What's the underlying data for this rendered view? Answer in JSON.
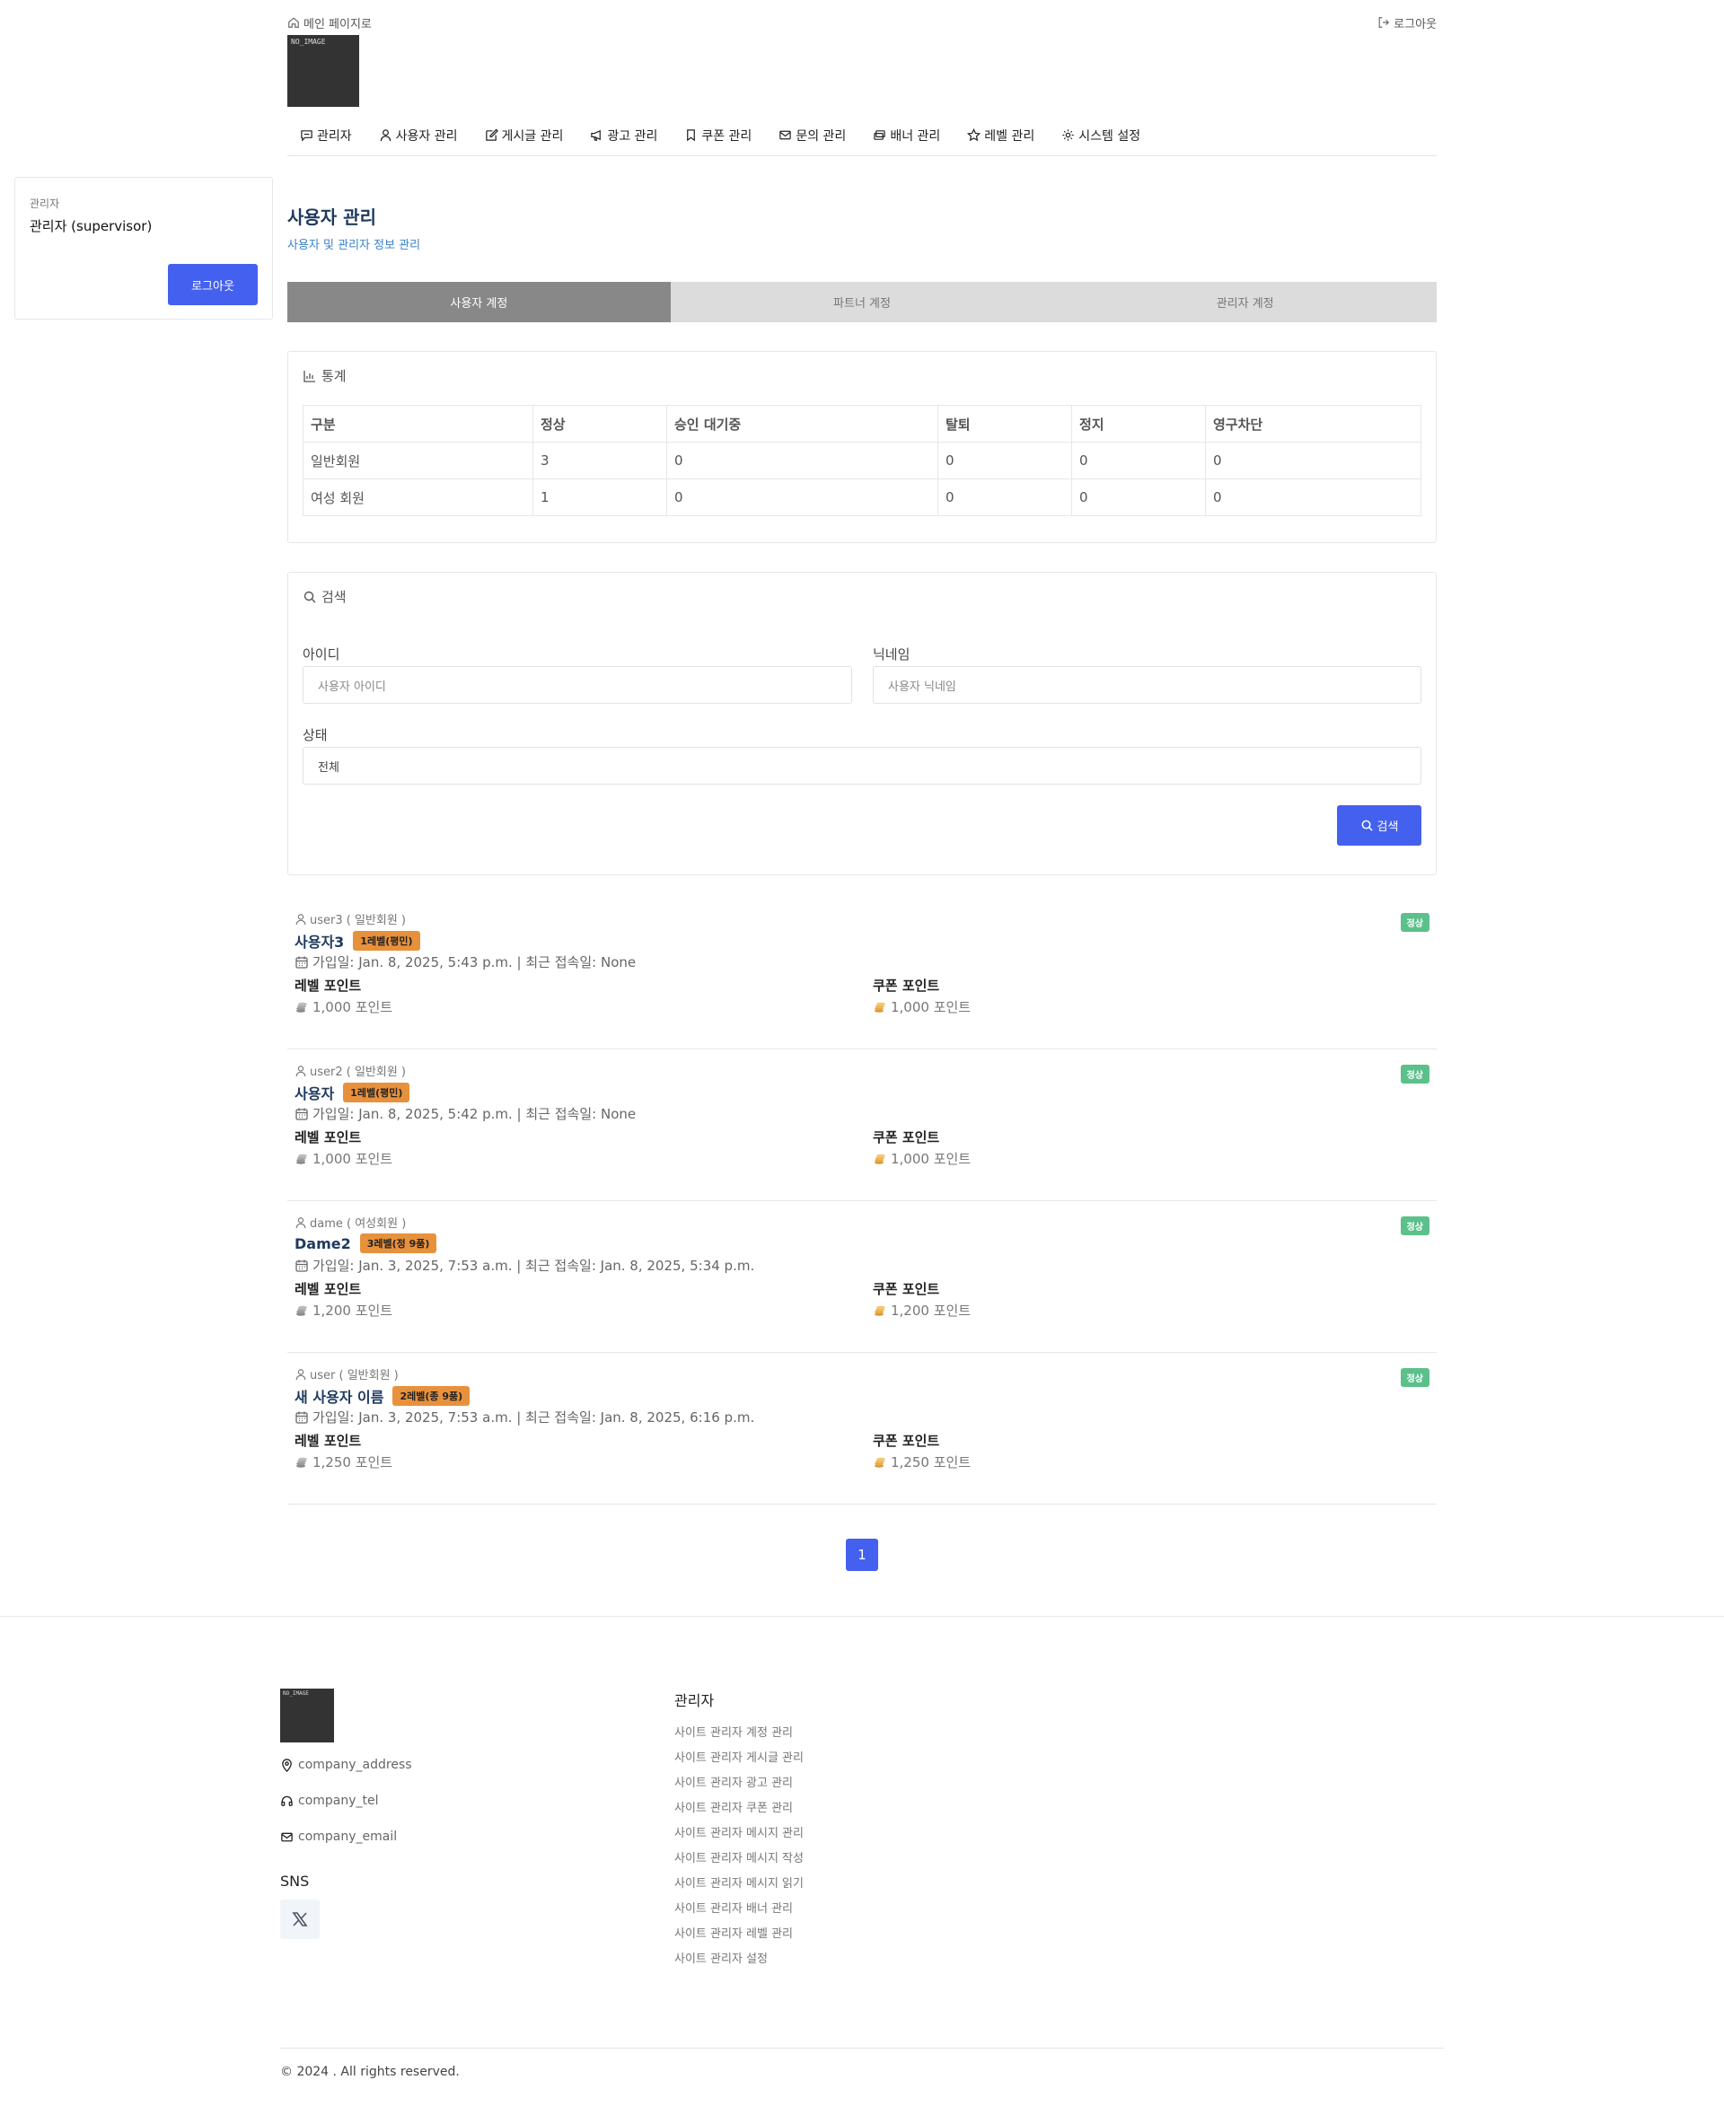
{
  "header": {
    "home_link": "메인 페이지로",
    "logout_link": "로그아웃",
    "logo_text": "NO_IMAGE"
  },
  "nav": {
    "items": [
      {
        "label": "관리자",
        "icon": "chat-icon"
      },
      {
        "label": "사용자 관리",
        "icon": "user-icon"
      },
      {
        "label": "게시글 관리",
        "icon": "edit-icon"
      },
      {
        "label": "광고 관리",
        "icon": "megaphone-icon"
      },
      {
        "label": "쿠폰 관리",
        "icon": "coupon-icon"
      },
      {
        "label": "문의 관리",
        "icon": "mail-icon"
      },
      {
        "label": "배너 관리",
        "icon": "banner-icon"
      },
      {
        "label": "레벨 관리",
        "icon": "star-icon"
      },
      {
        "label": "시스템 설정",
        "icon": "gear-icon"
      }
    ]
  },
  "sidebar": {
    "role": "관리자",
    "user": "관리자 (supervisor)",
    "logout_button": "로그아웃"
  },
  "page": {
    "title": "사용자 관리",
    "subtitle": "사용자 및 관리자 정보 관리"
  },
  "tabs": [
    {
      "label": "사용자 계정",
      "active": true
    },
    {
      "label": "파트너 계정",
      "active": false
    },
    {
      "label": "관리자 계정",
      "active": false
    }
  ],
  "stats": {
    "title": "통계",
    "headers": [
      "구분",
      "정상",
      "승인 대기중",
      "탈퇴",
      "정지",
      "영구차단"
    ],
    "rows": [
      [
        "일반회원",
        "3",
        "0",
        "0",
        "0",
        "0"
      ],
      [
        "여성 회원",
        "1",
        "0",
        "0",
        "0",
        "0"
      ]
    ]
  },
  "search": {
    "title": "검색",
    "id_label": "아이디",
    "id_placeholder": "사용자 아이디",
    "nick_label": "닉네임",
    "nick_placeholder": "사용자 닉네임",
    "status_label": "상태",
    "status_value": "전체",
    "button": "검색"
  },
  "users": [
    {
      "id": "user3 ( 일반회원 )",
      "name": "사용자3",
      "level": "1레벨(평민)",
      "dates": "가입일: Jan. 8, 2025, 5:43 p.m. | 최근 접속일: None",
      "level_point_label": "레벨 포인트",
      "level_point": "1,000 포인트",
      "coupon_point_label": "쿠폰 포인트",
      "coupon_point": "1,000 포인트",
      "status": "정상"
    },
    {
      "id": "user2 ( 일반회원 )",
      "name": "사용자",
      "level": "1레벨(평민)",
      "dates": "가입일: Jan. 8, 2025, 5:42 p.m. | 최근 접속일: None",
      "level_point_label": "레벨 포인트",
      "level_point": "1,000 포인트",
      "coupon_point_label": "쿠폰 포인트",
      "coupon_point": "1,000 포인트",
      "status": "정상"
    },
    {
      "id": "dame ( 여성회원 )",
      "name": "Dame2",
      "level": "3레벨(정 9품)",
      "dates": "가입일: Jan. 3, 2025, 7:53 a.m. | 최근 접속일: Jan. 8, 2025, 5:34 p.m.",
      "level_point_label": "레벨 포인트",
      "level_point": "1,200 포인트",
      "coupon_point_label": "쿠폰 포인트",
      "coupon_point": "1,200 포인트",
      "status": "정상"
    },
    {
      "id": "user ( 일반회원 )",
      "name": "새 사용자 이름",
      "level": "2레벨(종 9품)",
      "dates": "가입일: Jan. 3, 2025, 7:53 a.m. | 최근 접속일: Jan. 8, 2025, 6:16 p.m.",
      "level_point_label": "레벨 포인트",
      "level_point": "1,250 포인트",
      "coupon_point_label": "쿠폰 포인트",
      "coupon_point": "1,250 포인트",
      "status": "정상"
    }
  ],
  "pagination": {
    "current": "1"
  },
  "footer": {
    "logo_text": "NO_IMAGE",
    "address": "company_address",
    "tel": "company_tel",
    "email": "company_email",
    "sns_title": "SNS",
    "column_title": "관리자",
    "links": [
      "사이트 관리자 계정 관리",
      "사이트 관리자 게시글 관리",
      "사이트 관리자 광고 관리",
      "사이트 관리자 쿠폰 관리",
      "사이트 관리자 메시지 관리",
      "사이트 관리자 메시지 작성",
      "사이트 관리자 메시지 읽기",
      "사이트 관리자 배너 관리",
      "사이트 관리자 레벨 관리",
      "사이트 관리자 설정"
    ],
    "copyright": "© 2024 . All rights reserved."
  },
  "colors": {
    "primary": "#4361ee",
    "title": "#1e3a5f",
    "level_badge": "#e8913c",
    "status_badge": "#5cc08b",
    "tab_active": "#888888",
    "tab_inactive": "#dcdcdc"
  }
}
